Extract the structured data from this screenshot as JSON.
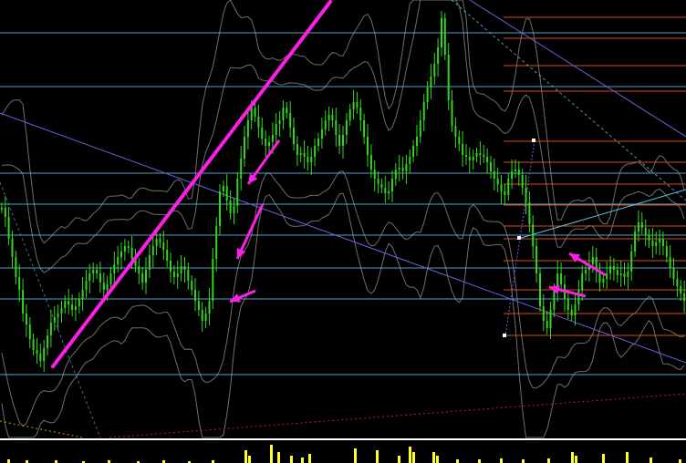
{
  "chart_data": {
    "type": "candlestick",
    "title": "",
    "grid": false,
    "colors": {
      "background": "#000000",
      "candles": "#33d61f",
      "level_lines": "#5fc1ea",
      "fib_levels": "#e8561f",
      "channel": "#6b63e0",
      "bands": "#6e6e6e",
      "trendline": "#ff1ee6",
      "arrows": "#ff1ee6",
      "indicator": "#ffff24",
      "separator": "#ffffff",
      "ma_red": "#c4201c"
    },
    "price_range": [
      0,
      480
    ],
    "horizontal_levels": [
      36,
      95,
      190,
      224,
      258,
      294,
      328,
      411
    ],
    "fib_levels": [
      19,
      42,
      72,
      100,
      155,
      178,
      202,
      225,
      248,
      262,
      286,
      318,
      344,
      368
    ],
    "close": [
      228,
      238,
      262,
      282,
      304,
      318,
      344,
      356,
      372,
      384,
      388,
      396,
      382,
      368,
      354,
      348,
      344,
      338,
      330,
      334,
      340,
      336,
      328,
      318,
      308,
      300,
      296,
      300,
      310,
      318,
      312,
      300,
      290,
      282,
      276,
      270,
      272,
      284,
      292,
      300,
      310,
      296,
      280,
      270,
      262,
      266,
      274,
      286,
      298,
      304,
      300,
      292,
      296,
      308,
      318,
      330,
      340,
      352,
      344,
      330,
      284,
      248,
      210,
      204,
      220,
      234,
      226,
      196,
      174,
      150,
      132,
      118,
      128,
      140,
      152,
      160,
      156,
      148,
      136,
      132,
      118,
      124,
      140,
      158,
      170,
      168,
      172,
      178,
      172,
      160,
      152,
      142,
      132,
      126,
      132,
      148,
      160,
      148,
      132,
      120,
      112,
      118,
      132,
      150,
      170,
      186,
      196,
      202,
      206,
      212,
      210,
      196,
      186,
      184,
      188,
      180,
      172,
      160,
      150,
      132,
      112,
      96,
      84,
      70,
      52,
      20,
      60,
      110,
      138,
      150,
      158,
      170,
      172,
      176,
      172,
      168,
      170,
      172,
      178,
      188,
      196,
      202,
      210,
      214,
      196,
      188,
      186,
      192,
      206,
      222,
      246,
      270,
      300,
      336,
      352,
      360,
      340,
      318,
      300,
      312,
      328,
      340,
      346,
      334,
      318,
      300,
      296,
      290,
      282,
      296,
      310,
      306,
      300,
      292,
      296,
      302,
      300,
      304,
      298,
      276,
      254,
      244,
      250,
      258,
      264,
      270,
      266,
      262,
      270,
      282,
      294,
      306,
      314,
      322,
      330
    ],
    "arrows": [
      {
        "from": [
          306,
          154
        ],
        "to": [
          272,
          202
        ]
      },
      {
        "from": [
          288,
          224
        ],
        "to": [
          260,
          284
        ]
      },
      {
        "from": [
          280,
          319
        ],
        "to": [
          252,
          331
        ]
      },
      {
        "from": [
          664,
          302
        ],
        "to": [
          624,
          278
        ]
      },
      {
        "from": [
          642,
          325
        ],
        "to": [
          602,
          315
        ]
      }
    ]
  }
}
